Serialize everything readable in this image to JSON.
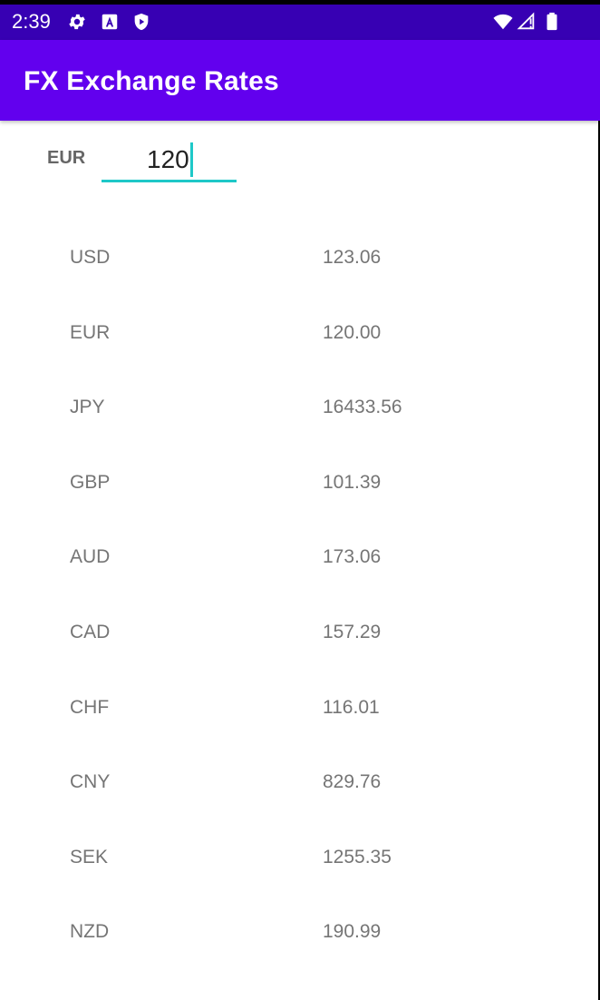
{
  "status_bar": {
    "time": "2:39",
    "icons": [
      "gear-icon",
      "font-a-icon",
      "shield-icon",
      "wifi-icon",
      "cell-signal-icon",
      "battery-icon"
    ]
  },
  "app_bar": {
    "title": "FX Exchange Rates"
  },
  "converter": {
    "base_currency": "EUR",
    "amount": "120"
  },
  "rates": [
    {
      "code": "USD",
      "value": "123.06"
    },
    {
      "code": "EUR",
      "value": "120.00"
    },
    {
      "code": "JPY",
      "value": "16433.56"
    },
    {
      "code": "GBP",
      "value": "101.39"
    },
    {
      "code": "AUD",
      "value": "173.06"
    },
    {
      "code": "CAD",
      "value": "157.29"
    },
    {
      "code": "CHF",
      "value": "116.01"
    },
    {
      "code": "CNY",
      "value": "829.76"
    },
    {
      "code": "SEK",
      "value": "1255.35"
    },
    {
      "code": "NZD",
      "value": "190.99"
    }
  ],
  "colors": {
    "status_bar": "#3700b3",
    "app_bar": "#6200ee",
    "accent": "#1ec8c8",
    "row_text": "#757575"
  }
}
